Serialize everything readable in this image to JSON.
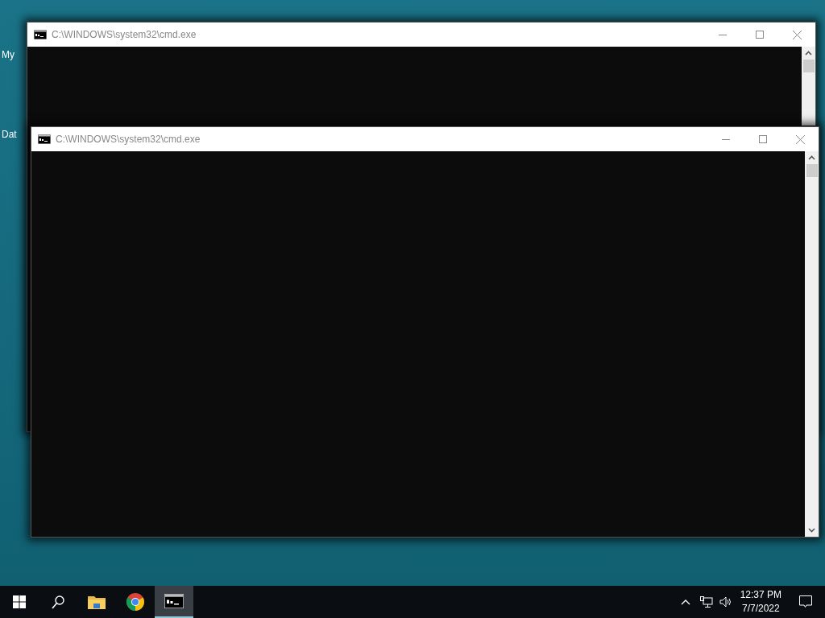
{
  "desktop": {
    "icons": [
      {
        "label": "My"
      },
      {
        "label": "Dat"
      }
    ]
  },
  "windows": [
    {
      "title": "C:\\WINDOWS\\system32\\cmd.exe"
    },
    {
      "title": "C:\\WINDOWS\\system32\\cmd.exe"
    }
  ],
  "taskbar": {
    "items": [
      {
        "kind": "start",
        "selected": false
      },
      {
        "kind": "search",
        "selected": false
      },
      {
        "kind": "explorer",
        "selected": false
      },
      {
        "kind": "chrome",
        "selected": false
      },
      {
        "kind": "cmd",
        "selected": true
      }
    ],
    "clock": {
      "time": "12:37 PM",
      "date": "7/7/2022"
    }
  }
}
